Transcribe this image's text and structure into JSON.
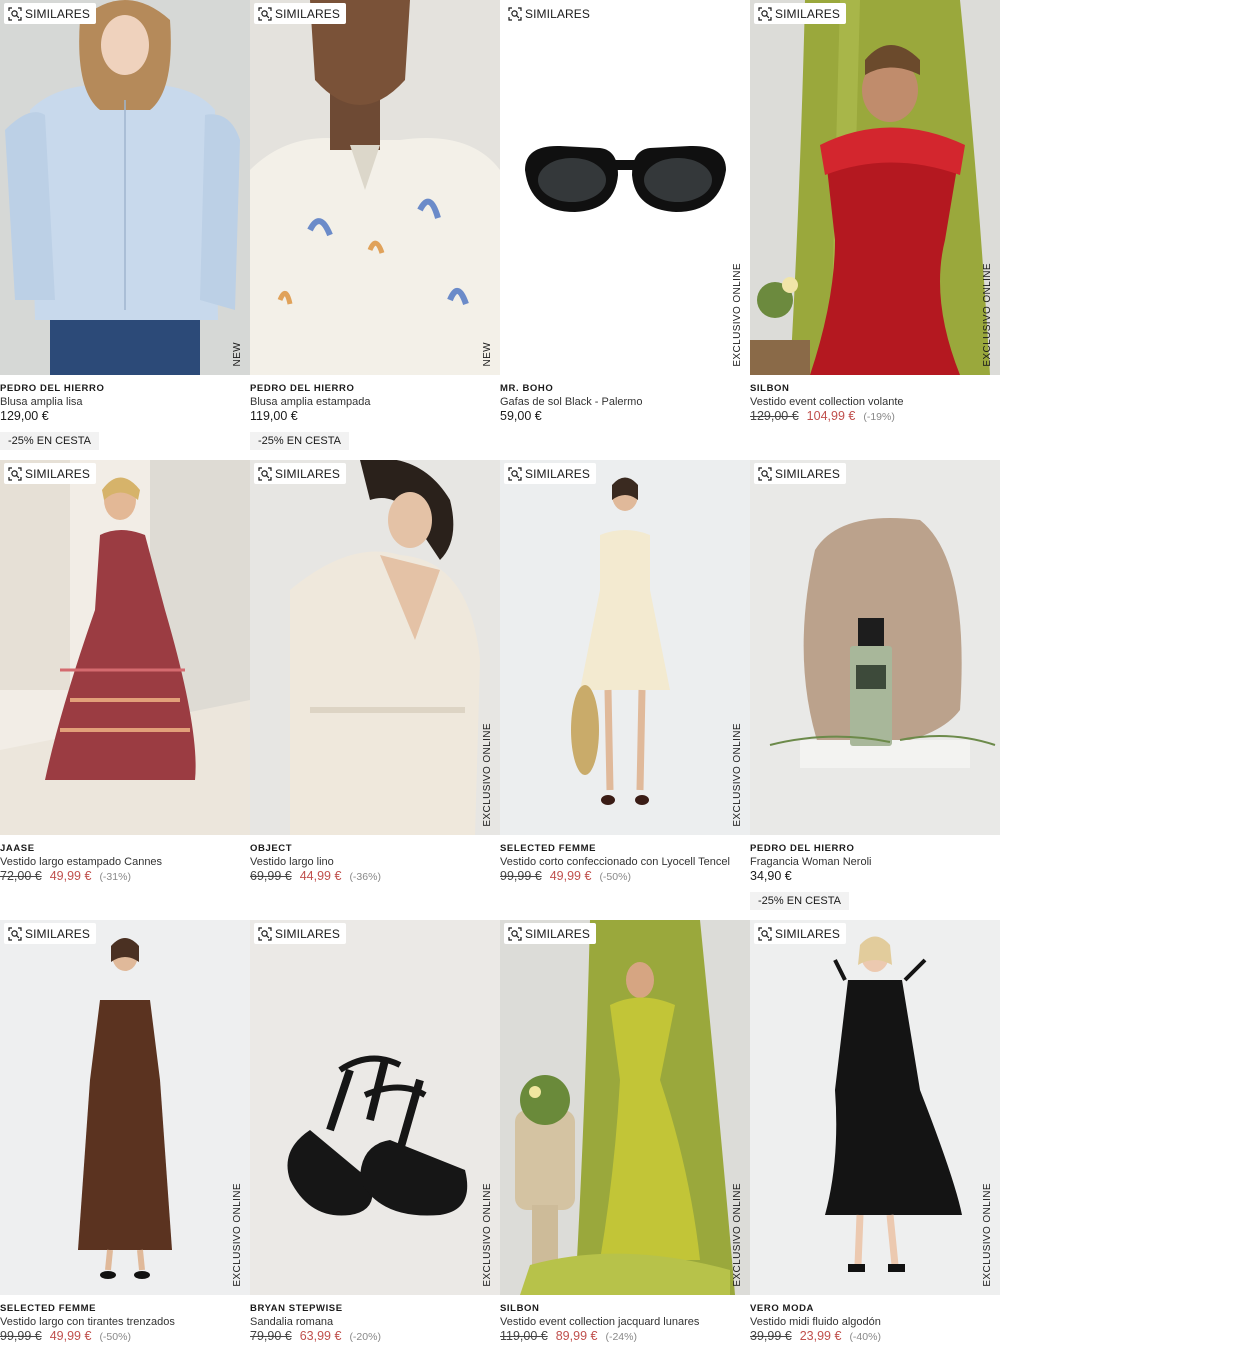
{
  "ui": {
    "similar_label": "SIMILARES"
  },
  "products": [
    {
      "brand": "PEDRO DEL HIERRO",
      "name": "Blusa amplia lisa",
      "price": "129,00 €",
      "promo": "-25% EN CESTA",
      "tag": "NEW",
      "image": "woman-light-blue-blouse"
    },
    {
      "brand": "PEDRO DEL HIERRO",
      "name": "Blusa amplia estampada",
      "price": "119,00 €",
      "promo": "-25% EN CESTA",
      "tag": "NEW",
      "image": "woman-printed-white-blouse"
    },
    {
      "brand": "MR. BOHO",
      "name": "Gafas de sol Black - Palermo",
      "price": "59,00 €",
      "tag": "EXCLUSIVO ONLINE",
      "image": "black-sunglasses"
    },
    {
      "brand": "SILBON",
      "name": "Vestido event collection volante",
      "old_price": "129,00 €",
      "sale_price": "104,99 €",
      "discount": "(-19%)",
      "tag": "EXCLUSIVO ONLINE",
      "image": "red-ruffle-dress"
    },
    {
      "brand": "JAASE",
      "name": "Vestido largo estampado Cannes",
      "old_price": "72,00 €",
      "sale_price": "49,99 €",
      "discount": "(-31%)",
      "image": "printed-maxi-dress"
    },
    {
      "brand": "OBJECT",
      "name": "Vestido largo lino",
      "old_price": "69,99 €",
      "sale_price": "44,99 €",
      "discount": "(-36%)",
      "tag": "EXCLUSIVO ONLINE",
      "image": "linen-wrap-dress"
    },
    {
      "brand": "SELECTED FEMME",
      "name": "Vestido corto confeccionado con Lyocell Tencel",
      "old_price": "99,99 €",
      "sale_price": "49,99 €",
      "discount": "(-50%)",
      "tag": "EXCLUSIVO ONLINE",
      "image": "cream-short-dress"
    },
    {
      "brand": "PEDRO DEL HIERRO",
      "name": "Fragancia Woman Neroli",
      "price": "34,90 €",
      "promo": "-25% EN CESTA",
      "image": "perfume-bottle"
    },
    {
      "brand": "SELECTED FEMME",
      "name": "Vestido largo con tirantes trenzados",
      "old_price": "99,99 €",
      "sale_price": "49,99 €",
      "discount": "(-50%)",
      "tag": "EXCLUSIVO ONLINE",
      "image": "brown-satin-dress"
    },
    {
      "brand": "BRYAN STEPWISE",
      "name": "Sandalia romana",
      "old_price": "79,90 €",
      "sale_price": "63,99 €",
      "discount": "(-20%)",
      "tag": "EXCLUSIVO ONLINE",
      "image": "black-sandals"
    },
    {
      "brand": "SILBON",
      "name": "Vestido event collection jacquard lunares",
      "old_price": "119,00 €",
      "sale_price": "89,99 €",
      "discount": "(-24%)",
      "tag": "EXCLUSIVO ONLINE",
      "image": "lime-ruffle-dress"
    },
    {
      "brand": "VERO MODA",
      "name": "Vestido midi fluido algodón",
      "old_price": "39,99 €",
      "sale_price": "23,99 €",
      "discount": "(-40%)",
      "tag": "EXCLUSIVO ONLINE",
      "image": "black-midi-dress"
    }
  ]
}
